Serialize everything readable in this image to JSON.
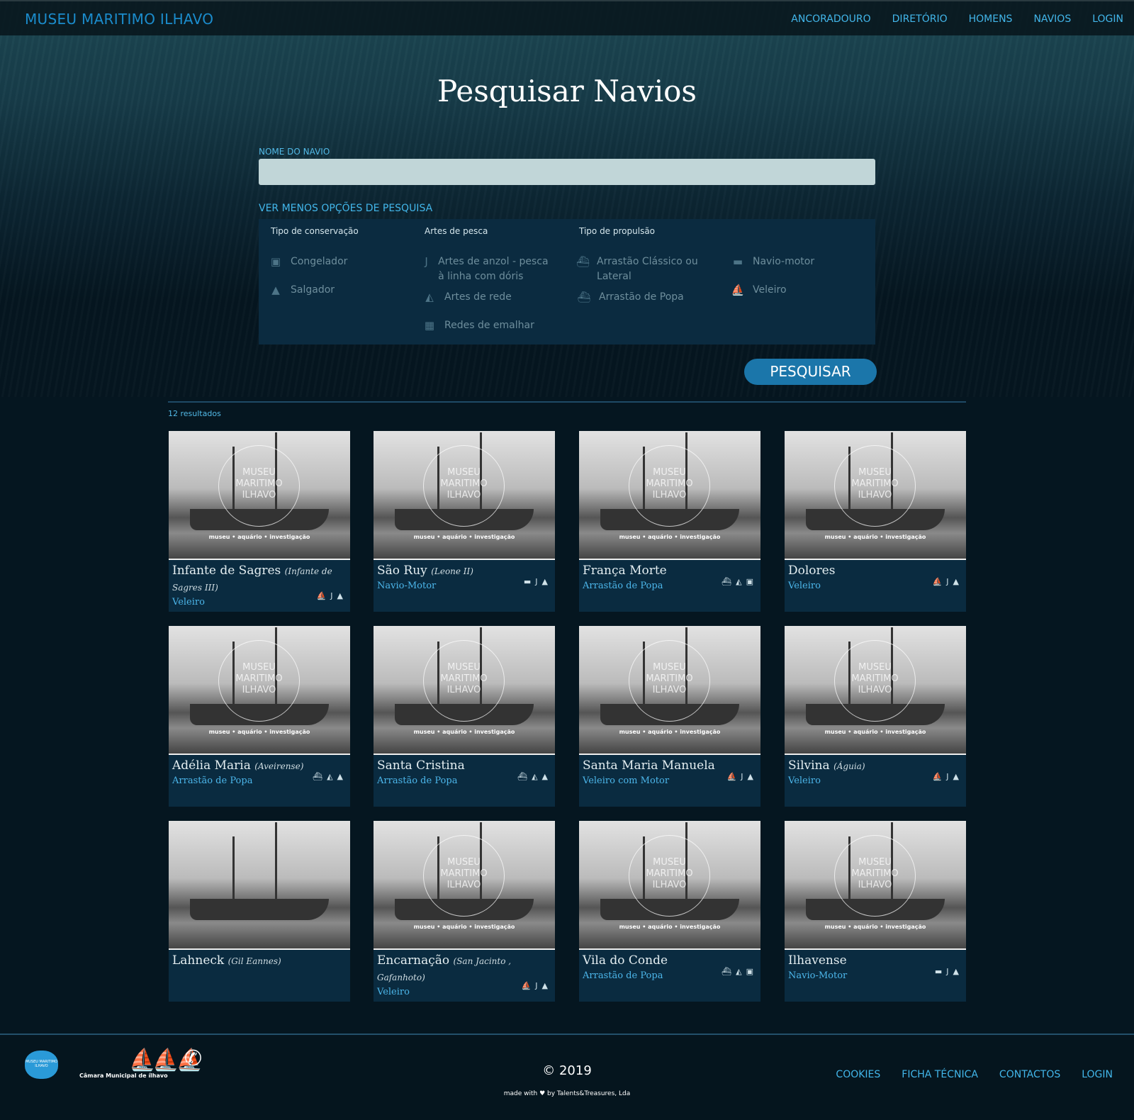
{
  "header": {
    "brand": "MUSEU MARITIMO ILHAVO",
    "nav": [
      "ANCORADOURO",
      "DIRETÓRIO",
      "HOMENS",
      "NAVIOS",
      "LOGIN"
    ]
  },
  "search": {
    "title": "Pesquisar Navios",
    "name_label": "NOME DO NAVIO",
    "name_value": "",
    "toggle": "VER MENOS OPÇÕES DE PESQUISA",
    "button": "PESQUISAR",
    "groups": {
      "conservacao": "Tipo de conservação",
      "artes": "Artes de pesca",
      "propulsao": "Tipo de propulsão"
    },
    "options": {
      "congelador": "Congelador",
      "salgador": "Salgador",
      "anzol": "Artes de anzol - pesca à linha com dóris",
      "rede": "Artes de rede",
      "emalhar": "Redes de emalhar",
      "classico": "Arrastão Clássico ou Lateral",
      "popa": "Arrastão de Popa",
      "motor": "Navio-motor",
      "veleiro": "Veleiro"
    }
  },
  "results": {
    "count": "12 resultados",
    "items": [
      {
        "name": "Infante de Sagres",
        "alias": "(Infante de Sagres III)",
        "type": "Veleiro",
        "icons": [
          "sailboat",
          "hook",
          "salt"
        ]
      },
      {
        "name": "São Ruy",
        "alias": "(Leone II)",
        "type": "Navio-Motor",
        "icons": [
          "motorship",
          "hook",
          "salt"
        ]
      },
      {
        "name": "França Morte",
        "alias": "",
        "type": "Arrastão de Popa",
        "icons": [
          "stern-trawler",
          "net",
          "freezer"
        ]
      },
      {
        "name": "Dolores",
        "alias": "",
        "type": "Veleiro",
        "icons": [
          "sailboat",
          "hook",
          "salt"
        ]
      },
      {
        "name": "Adélia Maria",
        "alias": "(Aveirense)",
        "type": "Arrastão de Popa",
        "icons": [
          "stern-trawler",
          "net",
          "salt"
        ]
      },
      {
        "name": "Santa Cristina",
        "alias": "",
        "type": "Arrastão de Popa",
        "icons": [
          "stern-trawler",
          "net",
          "salt"
        ]
      },
      {
        "name": "Santa Maria Manuela",
        "alias": "",
        "type": "Veleiro com Motor",
        "icons": [
          "sailboat",
          "hook",
          "salt"
        ]
      },
      {
        "name": "Silvina",
        "alias": "(Águia)",
        "type": "Veleiro",
        "icons": [
          "sailboat",
          "hook",
          "salt"
        ]
      },
      {
        "name": "Lahneck",
        "alias": "(Gil Eannes)",
        "type": "",
        "icons": []
      },
      {
        "name": "Encarnação",
        "alias": "(San Jacinto , Gafanhoto)",
        "type": "Veleiro",
        "icons": [
          "sailboat",
          "hook",
          "salt"
        ]
      },
      {
        "name": "Vila do Conde",
        "alias": "",
        "type": "Arrastão de Popa",
        "icons": [
          "stern-trawler",
          "net",
          "freezer"
        ]
      },
      {
        "name": "Ilhavense",
        "alias": "",
        "type": "Navio-Motor",
        "icons": [
          "motorship",
          "hook",
          "salt"
        ]
      }
    ],
    "watermark": "MUSEU MARITIMO ILHAVO",
    "watermark_caption": "museu • aquário • investigação"
  },
  "footer": {
    "copyright": "© 2019",
    "made": "made with ♥ by Talents&Treasures, Lda",
    "links": [
      "COOKIES",
      "FICHA TÉCNICA",
      "CONTACTOS",
      "LOGIN"
    ],
    "logos": {
      "museu": "MUSEU MARITIMO ILHAVO",
      "camara": "Câmara Municipal de",
      "camara_name": "ílhavo"
    }
  },
  "colors": {
    "accent": "#42b6ea",
    "panel": "#0b2b40",
    "button": "#1b76aa",
    "background": "#051620"
  }
}
